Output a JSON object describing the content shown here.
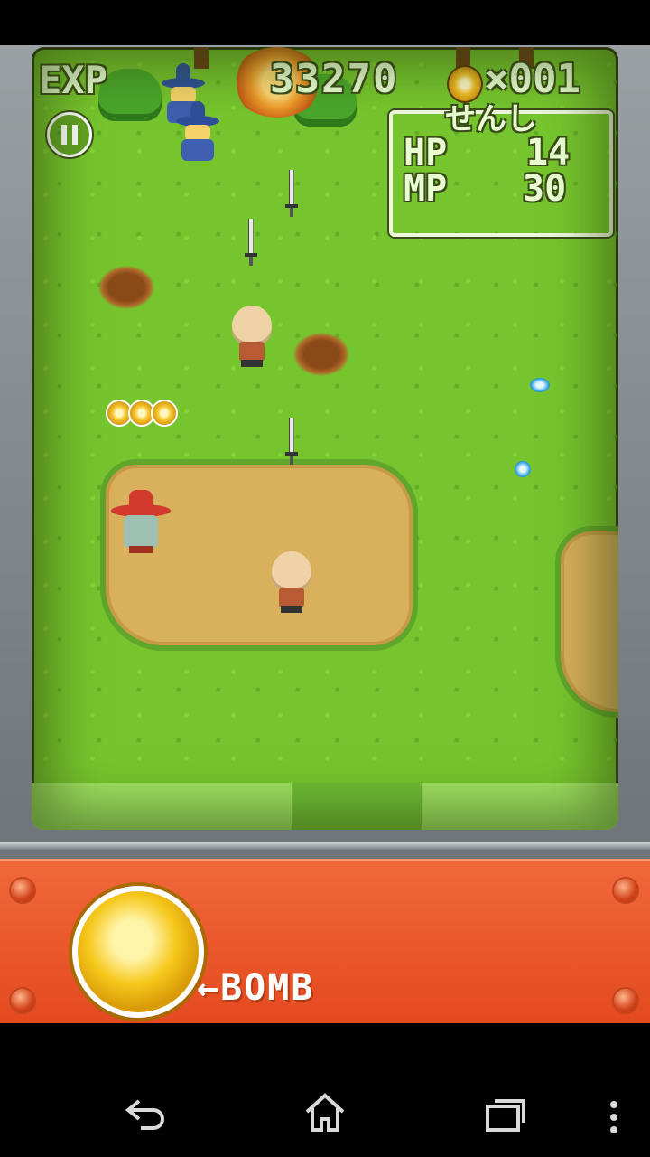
{
  "hud": {
    "exp_label": "EXP",
    "exp_value": "33270",
    "coin_multiplier": "×001",
    "class_name": "せんし",
    "hp_label": "HP",
    "hp_value": "14",
    "mp_label": "MP",
    "mp_value": "30"
  },
  "controls": {
    "bomb_label": "←BOMB"
  },
  "nav": {
    "back_icon": "back-icon",
    "home_icon": "home-icon",
    "recents_icon": "recents-icon",
    "menu_icon": "overflow-menu-icon"
  },
  "colors": {
    "grass": "#76c52e",
    "panel": "#e4491f",
    "bomb_button": "#f6c81c"
  }
}
